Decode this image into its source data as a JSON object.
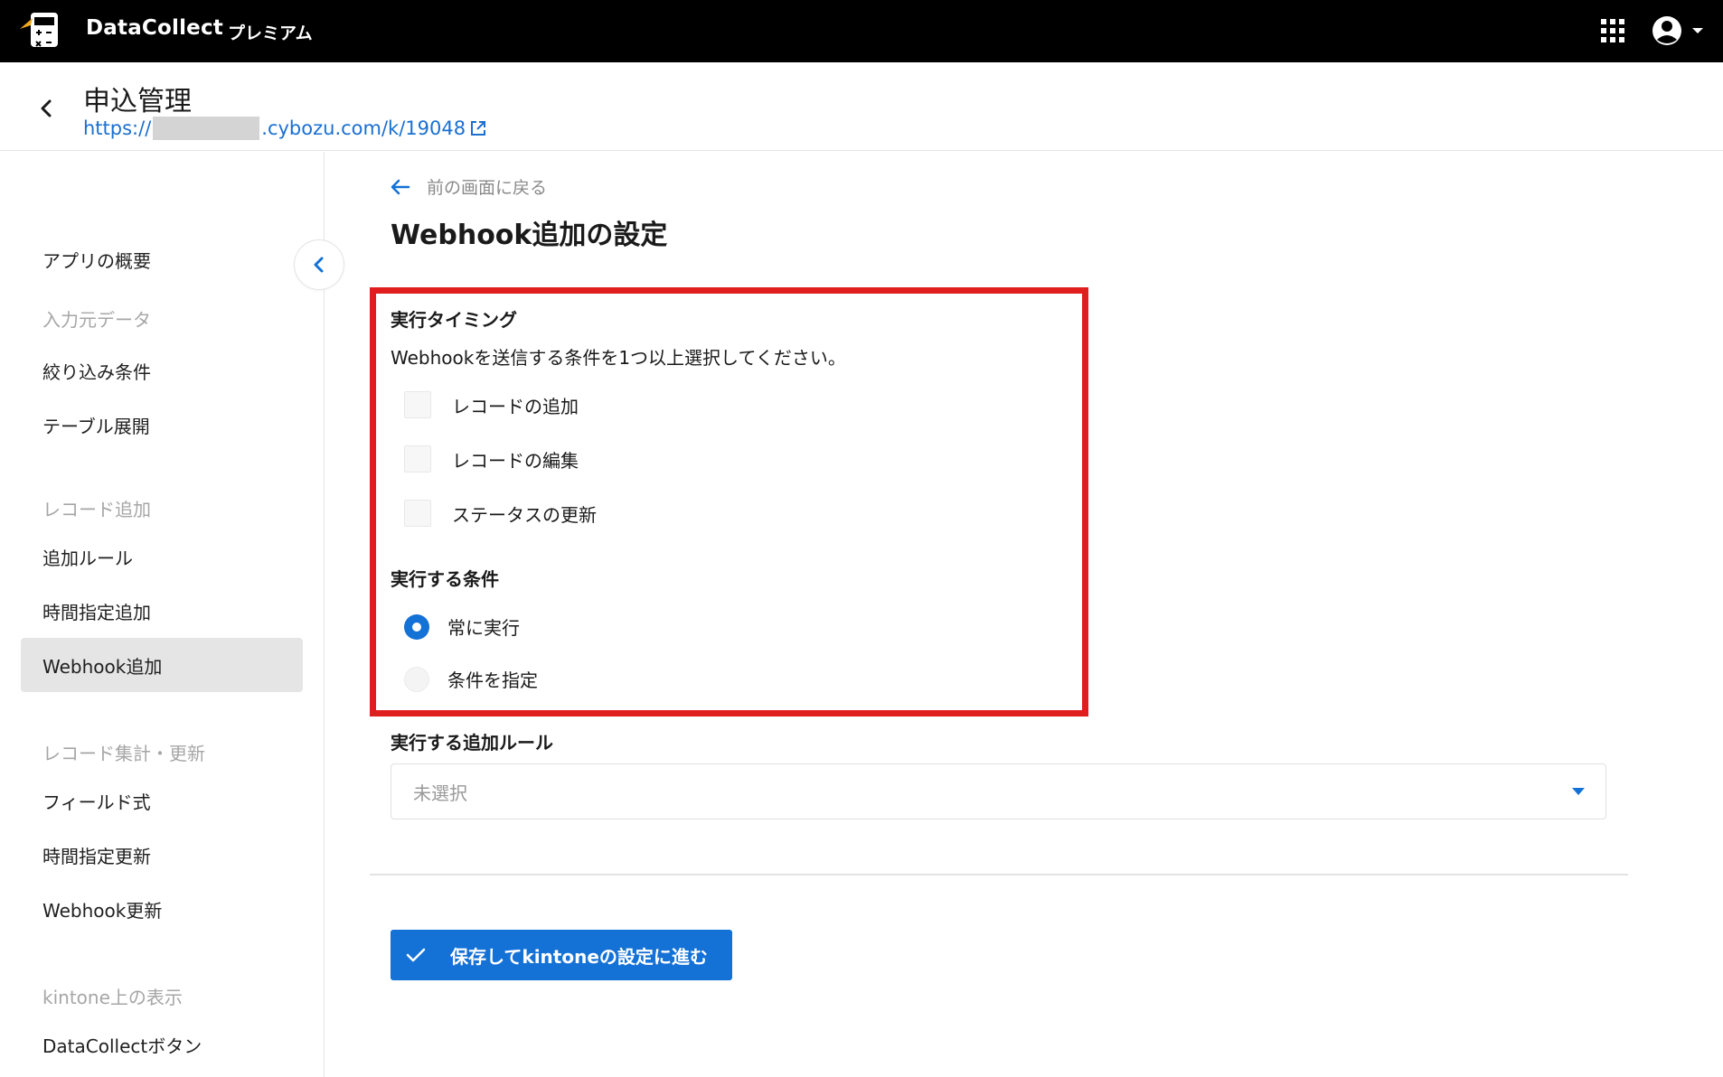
{
  "topbar": {
    "brand": "DataCollect",
    "plan": "プレミアム",
    "icons": [
      "calculator-logo-icon",
      "apps-grid-icon",
      "account-icon",
      "caret-down-icon"
    ]
  },
  "app_header": {
    "title": "申込管理",
    "url_prefix": "https://",
    "url_suffix": ".cybozu.com/k/19048"
  },
  "sidebar": {
    "items": [
      {
        "type": "item",
        "label": "アプリの概要"
      },
      {
        "type": "section",
        "label": "入力元データ"
      },
      {
        "type": "item",
        "label": "絞り込み条件"
      },
      {
        "type": "item",
        "label": "テーブル展開"
      },
      {
        "type": "section",
        "label": "レコード追加"
      },
      {
        "type": "item",
        "label": "追加ルール"
      },
      {
        "type": "item",
        "label": "時間指定追加"
      },
      {
        "type": "item",
        "label": "Webhook追加",
        "active": true
      },
      {
        "type": "section",
        "label": "レコード集計・更新"
      },
      {
        "type": "item",
        "label": "フィールド式"
      },
      {
        "type": "item",
        "label": "時間指定更新"
      },
      {
        "type": "item",
        "label": "Webhook更新"
      },
      {
        "type": "section",
        "label": "kintone上の表示"
      },
      {
        "type": "item",
        "label": "DataCollectボタン"
      }
    ]
  },
  "main": {
    "back_link": "前の画面に戻る",
    "title": "Webhook追加の設定",
    "timing": {
      "label": "実行タイミング",
      "description": "Webhookを送信する条件を1つ以上選択してください。",
      "options": [
        {
          "label": "レコードの追加",
          "checked": false
        },
        {
          "label": "レコードの編集",
          "checked": false
        },
        {
          "label": "ステータスの更新",
          "checked": false
        }
      ]
    },
    "condition": {
      "label": "実行する条件",
      "options": [
        {
          "label": "常に実行",
          "selected": true
        },
        {
          "label": "条件を指定",
          "selected": false
        }
      ]
    },
    "add_rule": {
      "label": "実行する追加ルール",
      "value": "未選択"
    },
    "save_button": "保存してkintoneの設定に進む"
  },
  "colors": {
    "accent": "#1471d6",
    "highlight_border": "#e01e1e",
    "topbar": "#000000",
    "link": "#1a6fd0"
  }
}
